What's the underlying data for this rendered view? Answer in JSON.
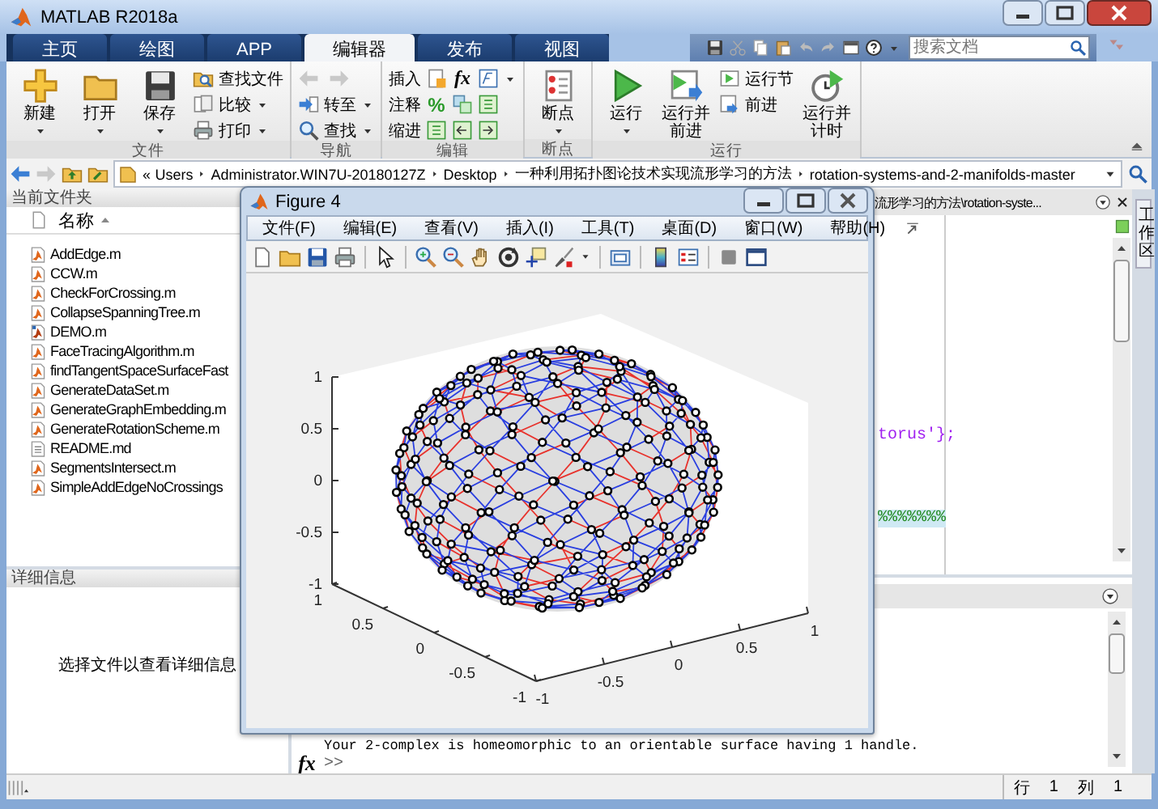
{
  "window": {
    "title": "MATLAB R2018a"
  },
  "tabs": [
    {
      "label": "主页",
      "selected": false
    },
    {
      "label": "绘图",
      "selected": false
    },
    {
      "label": "APP",
      "selected": false
    },
    {
      "label": "编辑器",
      "selected": true
    },
    {
      "label": "发布",
      "selected": false
    },
    {
      "label": "视图",
      "selected": false
    }
  ],
  "search": {
    "placeholder": "搜索文档"
  },
  "ribbon": [
    {
      "label": "文件",
      "items": [
        {
          "kind": "large",
          "label": "新建",
          "menu": true
        },
        {
          "kind": "large",
          "label": "打开",
          "menu": true
        },
        {
          "kind": "large",
          "label": "保存",
          "menu": true
        },
        {
          "kind": "small",
          "label": "查找文件",
          "menu": false
        },
        {
          "kind": "small",
          "label": "比较",
          "menu": true
        },
        {
          "kind": "small",
          "label": "打印",
          "menu": true
        }
      ]
    },
    {
      "label": "导航",
      "items": [
        {
          "kind": "small",
          "label": "转至",
          "menu": true
        },
        {
          "kind": "small",
          "label": "查找",
          "menu": true
        }
      ]
    },
    {
      "label": "编辑",
      "items": [
        {
          "kind": "row",
          "label": "插入",
          "glyph": "fx"
        },
        {
          "kind": "row",
          "label": "注释",
          "glyph": "%"
        },
        {
          "kind": "row",
          "label": "缩进"
        }
      ]
    },
    {
      "label": "断点",
      "items": [
        {
          "kind": "large",
          "label": "断点",
          "menu": true
        }
      ]
    },
    {
      "label": "运行",
      "items": [
        {
          "kind": "large",
          "label": "运行",
          "menu": true
        },
        {
          "kind": "large",
          "label": "运行并前进",
          "menu": false
        },
        {
          "kind": "small",
          "label": "运行节",
          "menu": false
        },
        {
          "kind": "small",
          "label": "前进",
          "menu": false
        },
        {
          "kind": "large",
          "label": "运行并计时",
          "menu": false
        }
      ]
    }
  ],
  "address": {
    "prefix": "«",
    "segments": [
      "Users",
      "Administrator.WIN7U-20180127Z",
      "Desktop",
      "一种利用拓扑图论技术实现流形学习的方法",
      "rotation-systems-and-2-manifolds-master"
    ]
  },
  "current_folder": {
    "title": "当前文件夹",
    "column": "名称",
    "files": [
      {
        "name": "AddEdge.m",
        "kind": "function"
      },
      {
        "name": "CCW.m",
        "kind": "function"
      },
      {
        "name": "CheckForCrossing.m",
        "kind": "function"
      },
      {
        "name": "CollapseSpanningTree.m",
        "kind": "function"
      },
      {
        "name": "DEMO.m",
        "kind": "script"
      },
      {
        "name": "FaceTracingAlgorithm.m",
        "kind": "function"
      },
      {
        "name": "findTangentSpaceSurfaceFast",
        "kind": "function"
      },
      {
        "name": "GenerateDataSet.m",
        "kind": "function"
      },
      {
        "name": "GenerateGraphEmbedding.m",
        "kind": "function"
      },
      {
        "name": "GenerateRotationScheme.m",
        "kind": "function"
      },
      {
        "name": "README.md",
        "kind": "text"
      },
      {
        "name": "SegmentsIntersect.m",
        "kind": "function"
      },
      {
        "name": "SimpleAddEdgeNoCrossings",
        "kind": "function"
      }
    ]
  },
  "details": {
    "title": "详细信息",
    "message": "选择文件以查看详细信息"
  },
  "editor": {
    "tab_title": "流形学习的方法\\rotation-syste...",
    "lines": [
      {
        "text": "torus'};",
        "kind": "string"
      },
      {
        "text": "%%%%%%%",
        "kind": "comment"
      }
    ]
  },
  "command_window": {
    "output": "Your 2-complex is homeomorphic to an orientable surface having 1 handle.",
    "fx": "fx",
    "prompt": ">>"
  },
  "side_tab": "工作区",
  "status_bar": {
    "row_label": "行",
    "row": "1",
    "col_label": "列",
    "col": "1"
  },
  "figure": {
    "title": "Figure 4",
    "menu": [
      "文件(F)",
      "编辑(E)",
      "查看(V)",
      "插入(I)",
      "工具(T)",
      "桌面(D)",
      "窗口(W)",
      "帮助(H)"
    ],
    "plot": {
      "z_ticks": [
        "1",
        "0.5",
        "0",
        "-0.5",
        "-1"
      ],
      "x_ticks": [
        "1",
        "0.5",
        "0",
        "-0.5",
        "-1"
      ],
      "y_ticks": [
        "-1",
        "-0.5",
        "0",
        "0.5",
        "1"
      ]
    }
  }
}
